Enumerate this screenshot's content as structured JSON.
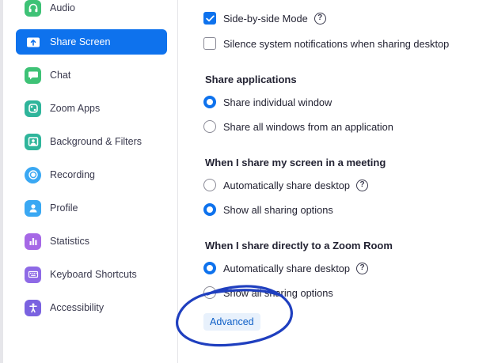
{
  "sidebar": {
    "items": [
      {
        "label": "Audio",
        "icon": "headphones-icon",
        "color": "#3ec276",
        "active": false
      },
      {
        "label": "Share Screen",
        "icon": "share-screen-icon",
        "color": "#0e72ed",
        "active": true
      },
      {
        "label": "Chat",
        "icon": "chat-icon",
        "color": "#3ec276",
        "active": false
      },
      {
        "label": "Zoom Apps",
        "icon": "zoom-apps-icon",
        "color": "#2fb59b",
        "active": false
      },
      {
        "label": "Background & Filters",
        "icon": "background-icon",
        "color": "#2fb59b",
        "active": false
      },
      {
        "label": "Recording",
        "icon": "recording-icon",
        "color": "#3aa8f3",
        "active": false
      },
      {
        "label": "Profile",
        "icon": "profile-icon",
        "color": "#3aa8f3",
        "active": false
      },
      {
        "label": "Statistics",
        "icon": "statistics-icon",
        "color": "#a668e6",
        "active": false
      },
      {
        "label": "Keyboard Shortcuts",
        "icon": "keyboard-icon",
        "color": "#8e6ae6",
        "active": false
      },
      {
        "label": "Accessibility",
        "icon": "accessibility-icon",
        "color": "#7a62e0",
        "active": false
      }
    ]
  },
  "main": {
    "side_by_side": {
      "label": "Side-by-side Mode",
      "checked": true
    },
    "silence": {
      "label": "Silence system notifications when sharing desktop",
      "checked": false
    },
    "share_apps": {
      "heading": "Share applications",
      "options": [
        {
          "label": "Share individual window",
          "selected": true
        },
        {
          "label": "Share all windows from an application",
          "selected": false
        }
      ]
    },
    "meeting": {
      "heading": "When I share my screen in a meeting",
      "options": [
        {
          "label": "Automatically share desktop",
          "selected": false,
          "help": true
        },
        {
          "label": "Show all sharing options",
          "selected": true
        }
      ]
    },
    "zoom_room": {
      "heading": "When I share directly to a Zoom Room",
      "options": [
        {
          "label": "Automatically share desktop",
          "selected": true,
          "help": true
        },
        {
          "label": "Show all sharing options",
          "selected": false
        }
      ]
    },
    "advanced_label": "Advanced",
    "help_glyph": "?"
  },
  "colors": {
    "accent": "#0e72ed",
    "annotation": "#1f3fbf"
  }
}
